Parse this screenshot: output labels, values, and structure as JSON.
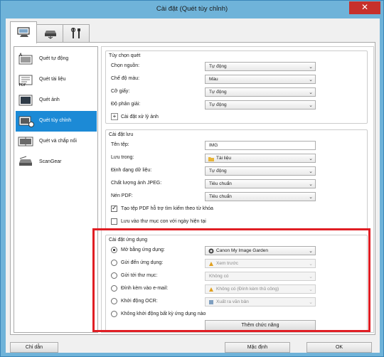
{
  "window": {
    "title": "Cài đặt (Quét tùy chỉnh)",
    "close_glyph": "✕"
  },
  "tabs": [
    {
      "icon": "scan-settings-icon",
      "active": true
    },
    {
      "icon": "scanner-icon",
      "active": false
    },
    {
      "icon": "tools-icon",
      "active": false
    }
  ],
  "nav": [
    {
      "label": "Quét tự động",
      "icon": "auto-scan-icon",
      "selected": false
    },
    {
      "label": "Quét tài liệu",
      "icon": "document-scan-icon",
      "selected": false
    },
    {
      "label": "Quét ảnh",
      "icon": "photo-scan-icon",
      "selected": false
    },
    {
      "label": "Quét tùy chỉnh",
      "icon": "custom-scan-icon",
      "selected": true
    },
    {
      "label": "Quét và chắp nối",
      "icon": "stitch-scan-icon",
      "selected": false
    },
    {
      "label": "ScanGear",
      "icon": "scangear-icon",
      "selected": false
    }
  ],
  "scan_options": {
    "title": "Tùy chọn quét",
    "source": {
      "label": "Chọn nguồn:",
      "value": "Tự động"
    },
    "color_mode": {
      "label": "Chế độ màu:",
      "value": "Màu"
    },
    "paper_size": {
      "label": "Cỡ giấy:",
      "value": "Tự động"
    },
    "resolution": {
      "label": "Độ phân giải:",
      "value": "Tự động"
    },
    "image_processing": "Cài đặt xử lý ảnh"
  },
  "save_settings": {
    "title": "Cài đặt lưu",
    "file_name": {
      "label": "Tên tệp:",
      "value": "IMG"
    },
    "save_in": {
      "label": "Lưu trong:",
      "value": "Tài liệu"
    },
    "data_format": {
      "label": "Định dạng dữ liệu:",
      "value": "Tự động"
    },
    "jpeg_quality": {
      "label": "Chất lượng ảnh JPEG:",
      "value": "Tiêu chuẩn"
    },
    "pdf_compression": {
      "label": "Nén PDF:",
      "value": "Tiêu chuẩn"
    },
    "searchable_pdf": {
      "label": "Tạo tệp PDF hỗ trợ tìm kiếm theo từ khóa",
      "checked": true
    },
    "save_subfolder": {
      "label": "Lưu vào thư mục con với ngày hiện tại",
      "checked": false
    }
  },
  "app_settings": {
    "title": "Cài đặt ứng dụng",
    "open_with": {
      "label": "Mở bằng ứng dụng:",
      "value": "Canon My Image Garden",
      "checked": true
    },
    "send_to_app": {
      "label": "Gửi đến ứng dụng:",
      "value": "Xem trước",
      "checked": false
    },
    "send_to_folder": {
      "label": "Gửi tới thư mục:",
      "value": "Không có",
      "checked": false
    },
    "attach_email": {
      "label": "Đính kèm vào e-mail:",
      "value": "Không có (Đính kèm thủ công)",
      "checked": false
    },
    "start_ocr": {
      "label": "Khởi động OCR:",
      "value": "Xuất ra văn bản",
      "checked": false
    },
    "no_app": {
      "label": "Không khởi động bất kỳ ứng dụng nào",
      "checked": false
    },
    "add_function": "Thêm chức năng"
  },
  "buttons": {
    "instructions": "Chỉ dẫn",
    "defaults": "Mặc định",
    "ok": "OK"
  },
  "colors": {
    "selected": "#1c8ad6",
    "highlight": "#e01e24",
    "frame": "#6fb3d9"
  }
}
